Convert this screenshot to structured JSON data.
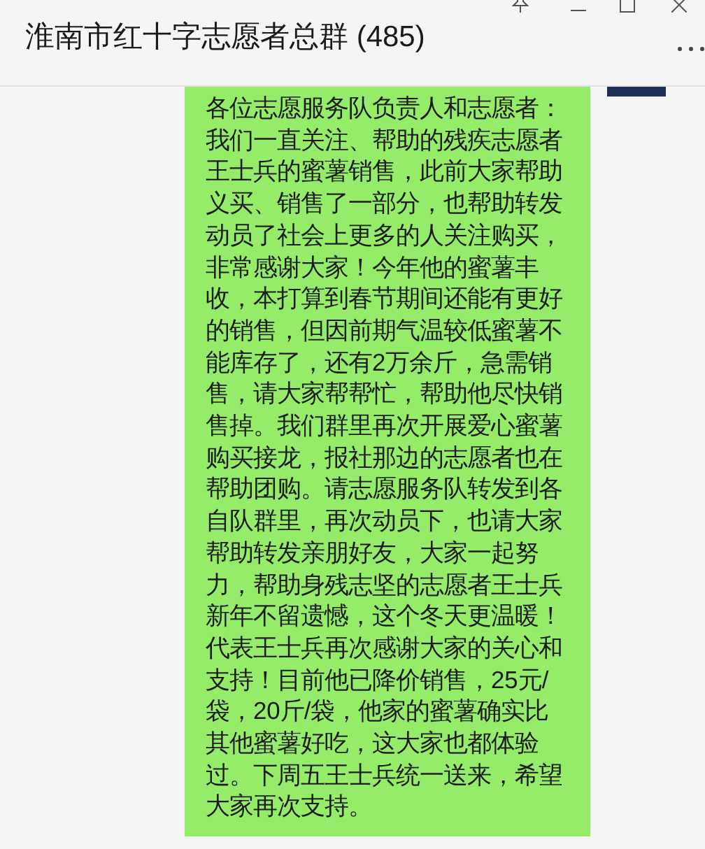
{
  "window": {
    "title": "淮南市红十字志愿者总群 (485)"
  },
  "message": {
    "lines": [
      "各位志愿服务队负责人和志愿者：",
      "我们一直关注、帮助的残疾志愿者",
      "王士兵的蜜薯销售，此前大家帮助",
      "义买、销售了一部分，也帮助转发",
      "动员了社会上更多的人关注购买，",
      "非常感谢大家！今年他的蜜薯丰",
      "收，本打算到春节期间还能有更好",
      "的销售，但因前期气温较低蜜薯不",
      "能库存了，还有2万余斤，急需销",
      "售，请大家帮帮忙，帮助他尽快销",
      "售掉。我们群里再次开展爱心蜜薯",
      "购买接龙，报社那边的志愿者也在",
      "帮助团购。请志愿服务队转发到各",
      "自队群里，再次动员下，也请大家",
      "帮助转发亲朋好友，大家一起努",
      "力，帮助身残志坚的志愿者王士兵",
      "新年不留遗憾，这个冬天更温暖！",
      "代表王士兵再次感谢大家的关心和",
      "支持！目前他已降价销售，25元/",
      "袋，20斤/袋，他家的蜜薯确实比",
      "其他蜜薯好吃，这大家也都体验",
      "过。下周五王士兵统一送来，希望",
      "大家再次支持。"
    ]
  }
}
